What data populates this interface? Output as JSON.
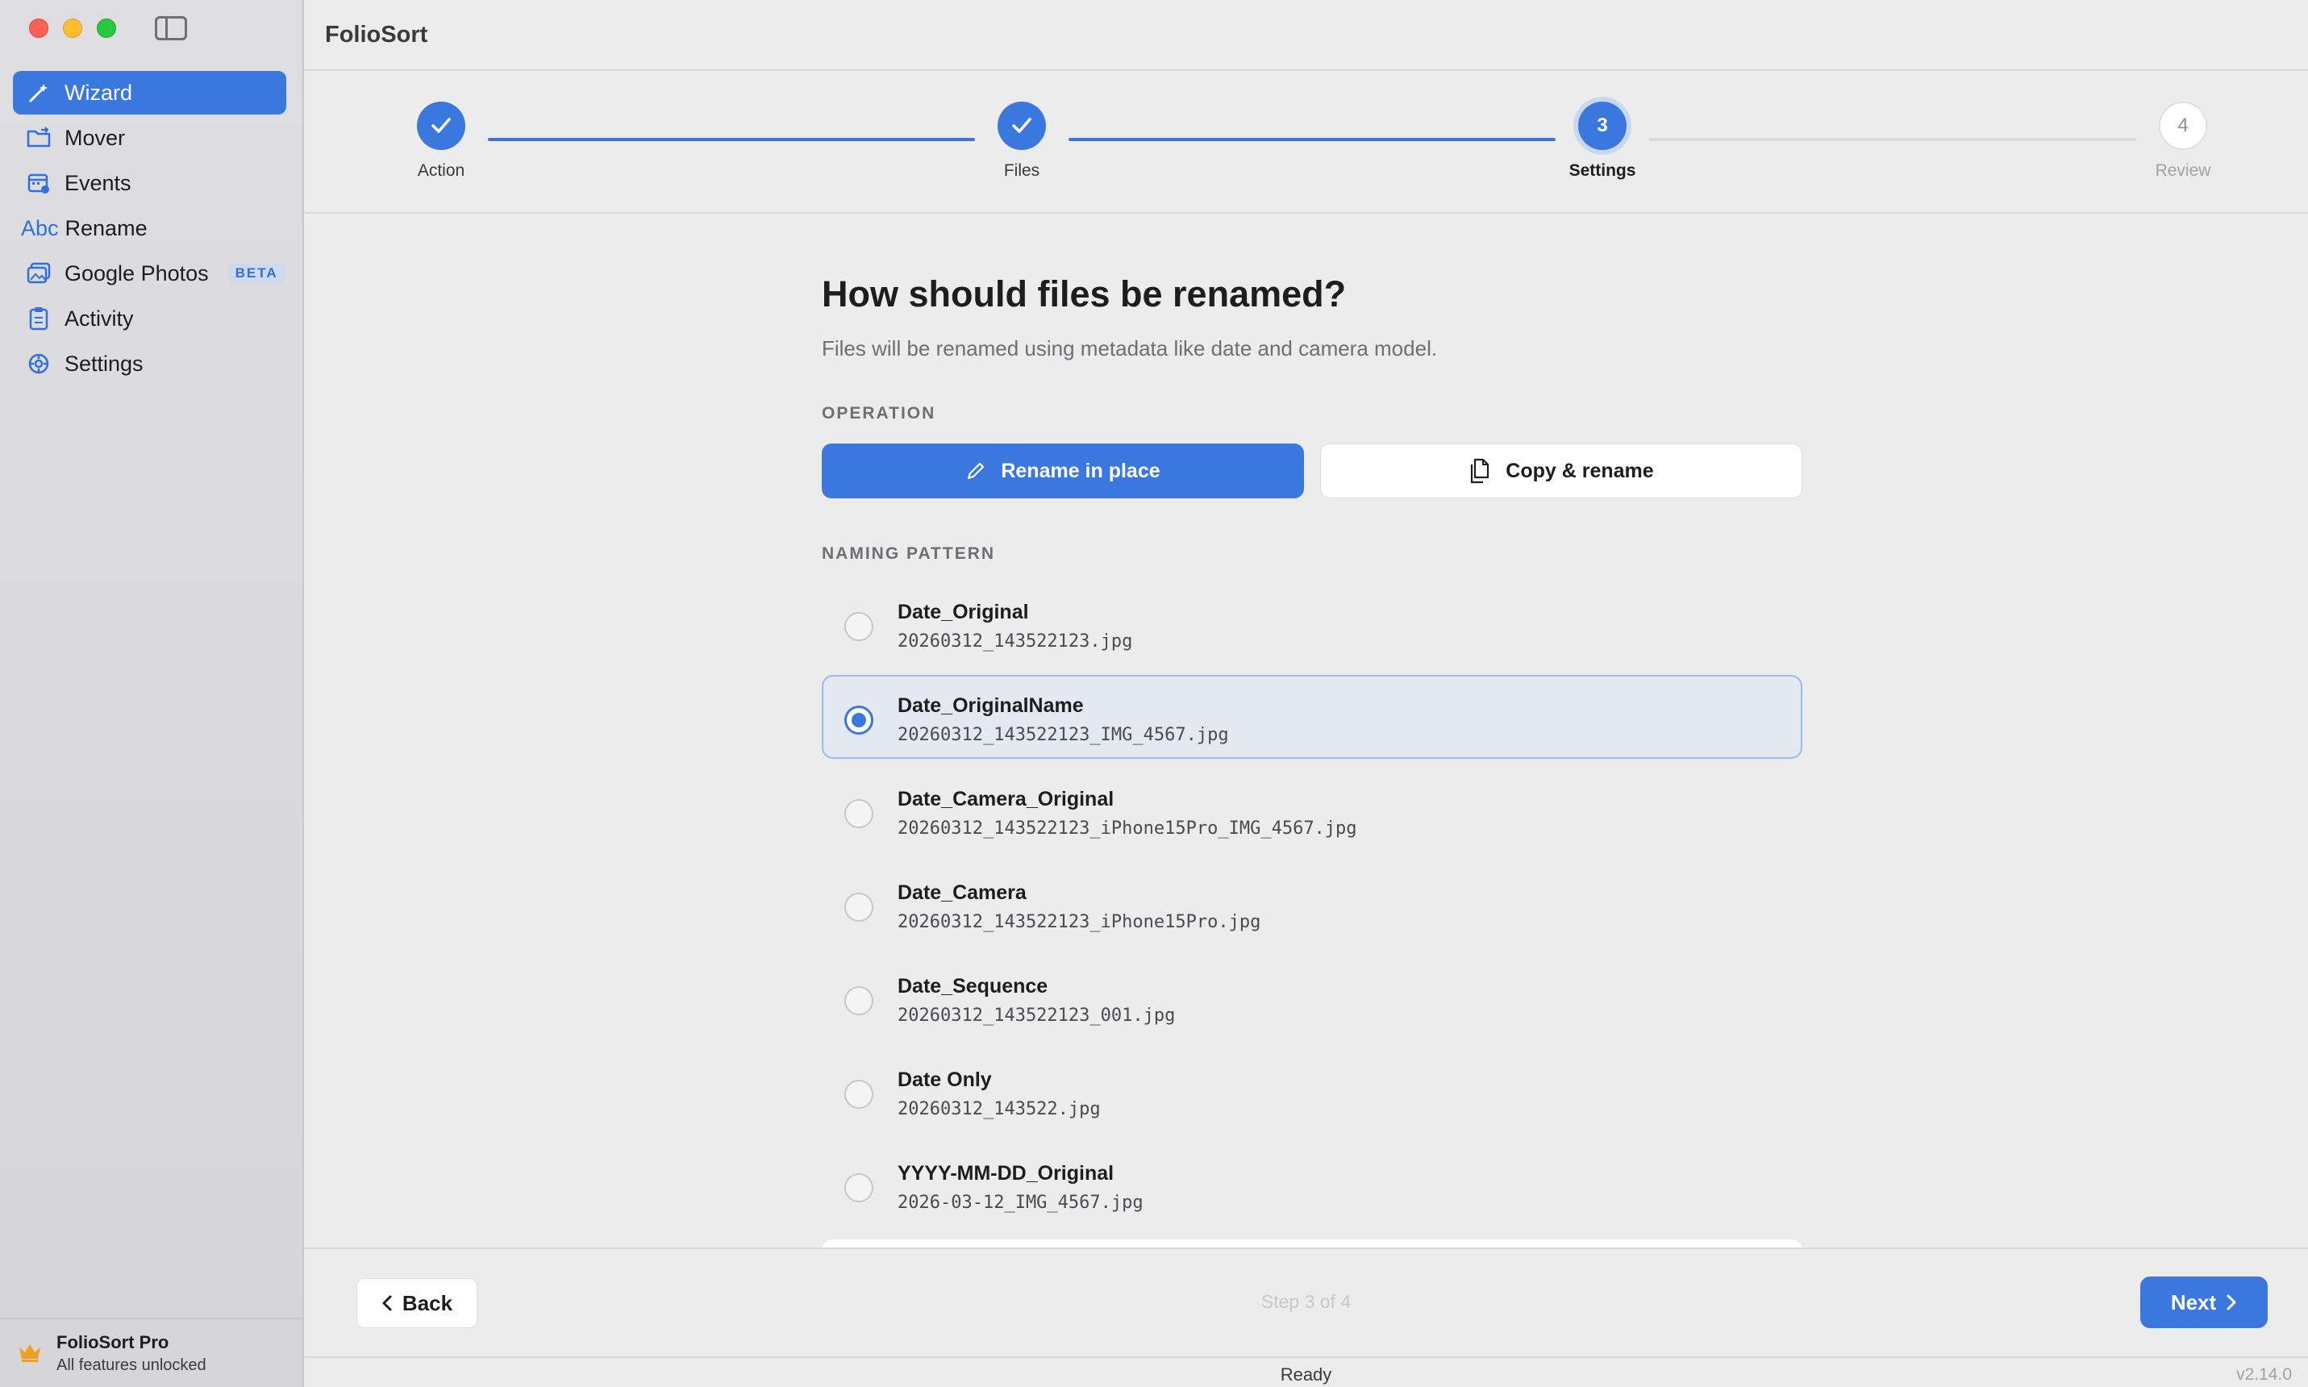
{
  "app": {
    "title": "FolioSort",
    "status": "Ready",
    "version": "v2.14.0"
  },
  "sidebar": {
    "items": [
      {
        "label": "Wizard",
        "icon": "magic-wand-icon",
        "active": true
      },
      {
        "label": "Mover",
        "icon": "folder-move-icon"
      },
      {
        "label": "Events",
        "icon": "calendar-icon"
      },
      {
        "label": "Rename",
        "icon": "abc-text-icon",
        "icon_text": "Abc"
      },
      {
        "label": "Google Photos",
        "icon": "photos-icon",
        "badge": "BETA"
      },
      {
        "label": "Activity",
        "icon": "clipboard-icon"
      },
      {
        "label": "Settings",
        "icon": "gear-icon"
      }
    ],
    "pro": {
      "title": "FolioSort Pro",
      "subtitle": "All features unlocked",
      "icon": "crown-icon"
    }
  },
  "wizard": {
    "steps": [
      {
        "label": "Action",
        "state": "done"
      },
      {
        "label": "Files",
        "state": "done"
      },
      {
        "label": "Settings",
        "state": "current",
        "number": "3"
      },
      {
        "label": "Review",
        "state": "pending",
        "number": "4"
      }
    ],
    "step_count": "Step 3 of 4",
    "back_label": "Back",
    "next_label": "Next"
  },
  "settings": {
    "heading": "How should files be renamed?",
    "subheading": "Files will be renamed using metadata like date and camera model.",
    "operation_label": "OPERATION",
    "operations": [
      {
        "label": "Rename in place",
        "icon": "pencil-icon",
        "selected": true
      },
      {
        "label": "Copy & rename",
        "icon": "copy-icon",
        "selected": false
      }
    ],
    "pattern_label": "NAMING PATTERN",
    "patterns": [
      {
        "name": "Date_Original",
        "example": "20260312_143522123.jpg",
        "selected": false
      },
      {
        "name": "Date_OriginalName",
        "example": "20260312_143522123_IMG_4567.jpg",
        "selected": true
      },
      {
        "name": "Date_Camera_Original",
        "example": "20260312_143522123_iPhone15Pro_IMG_4567.jpg",
        "selected": false
      },
      {
        "name": "Date_Camera",
        "example": "20260312_143522123_iPhone15Pro.jpg",
        "selected": false
      },
      {
        "name": "Date_Sequence",
        "example": "20260312_143522123_001.jpg",
        "selected": false
      },
      {
        "name": "Date Only",
        "example": "20260312_143522.jpg",
        "selected": false
      },
      {
        "name": "YYYY-MM-DD_Original",
        "example": "2026-03-12_IMG_4567.jpg",
        "selected": false
      }
    ]
  },
  "colors": {
    "accent": "#3a78e0",
    "traffic_red": "#fe5f57",
    "traffic_yellow": "#febc2e",
    "traffic_green": "#28c840"
  }
}
